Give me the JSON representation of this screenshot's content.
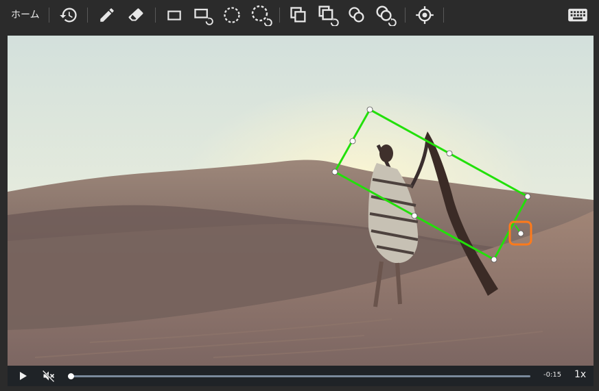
{
  "toolbar": {
    "home_label": "ホーム",
    "tools": [
      {
        "name": "history-icon"
      },
      {
        "name": "pencil-icon"
      },
      {
        "name": "eraser-icon"
      },
      {
        "name": "rectangle-icon"
      },
      {
        "name": "rotated-rectangle-icon"
      },
      {
        "name": "ellipse-icon"
      },
      {
        "name": "rotated-ellipse-icon"
      },
      {
        "name": "copy-rectangle-icon"
      },
      {
        "name": "copy-rotated-rectangle-icon"
      },
      {
        "name": "copy-ellipse-icon"
      },
      {
        "name": "copy-rotated-ellipse-icon"
      },
      {
        "name": "crosshair-icon"
      },
      {
        "name": "keyboard-icon"
      }
    ]
  },
  "annotation": {
    "box_color": "#22e00a",
    "handle_color": "#ffffff",
    "highlight_color": "#ff7a1a"
  },
  "player": {
    "time_remaining": "-0:15",
    "speed": "1x",
    "progress": 0.0
  }
}
